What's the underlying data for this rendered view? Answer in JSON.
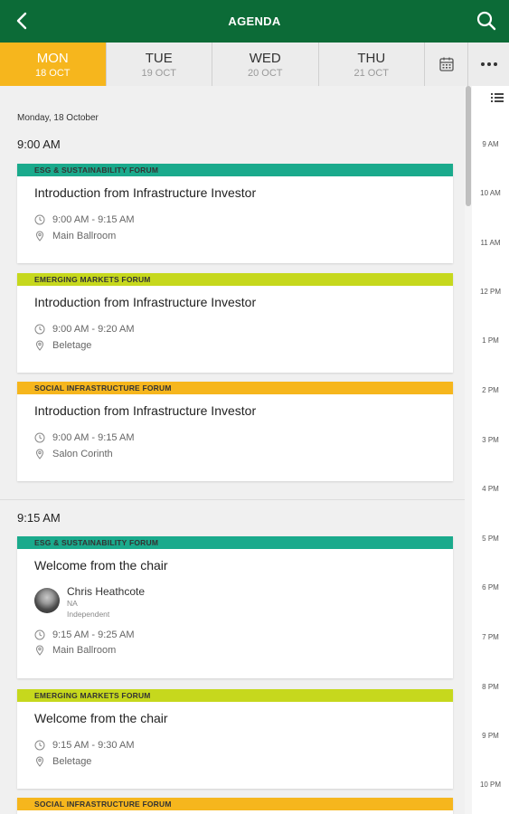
{
  "header": {
    "title": "AGENDA"
  },
  "day_tabs": [
    {
      "name": "MON",
      "date": "18 OCT",
      "active": true
    },
    {
      "name": "TUE",
      "date": "19 OCT",
      "active": false
    },
    {
      "name": "WED",
      "date": "20 OCT",
      "active": false
    },
    {
      "name": "THU",
      "date": "21 OCT",
      "active": false
    }
  ],
  "date_header": "Monday, 18 October",
  "time_groups": [
    {
      "time": "9:00 AM",
      "sessions": [
        {
          "track": "ESG & SUSTAINABILITY FORUM",
          "track_color": "#1aaa8c",
          "title": "Introduction from Infrastructure Investor",
          "time": "9:00 AM - 9:15 AM",
          "location": "Main Ballroom"
        },
        {
          "track": "EMERGING MARKETS FORUM",
          "track_color": "#c6d81d",
          "title": "Introduction from Infrastructure Investor",
          "time": "9:00 AM - 9:20 AM",
          "location": "Beletage"
        },
        {
          "track": "SOCIAL INFRASTRUCTURE FORUM",
          "track_color": "#f6b61d",
          "title": "Introduction from Infrastructure Investor",
          "time": "9:00 AM - 9:15 AM",
          "location": "Salon Corinth"
        }
      ]
    },
    {
      "time": "9:15 AM",
      "sessions": [
        {
          "track": "ESG & SUSTAINABILITY FORUM",
          "track_color": "#1aaa8c",
          "title": "Welcome from the chair",
          "speaker": {
            "name": "Chris Heathcote",
            "title": "NA",
            "org": "Independent"
          },
          "time": "9:15 AM - 9:25 AM",
          "location": "Main Ballroom"
        },
        {
          "track": "EMERGING MARKETS FORUM",
          "track_color": "#c6d81d",
          "title": "Welcome from the chair",
          "time": "9:15 AM - 9:30 AM",
          "location": "Beletage"
        },
        {
          "track": "SOCIAL INFRASTRUCTURE FORUM",
          "track_color": "#f6b61d"
        }
      ]
    }
  ],
  "timeline_labels": [
    "9 AM",
    "10 AM",
    "11 AM",
    "12 PM",
    "1 PM",
    "2 PM",
    "3 PM",
    "4 PM",
    "5 PM",
    "6 PM",
    "7 PM",
    "8 PM",
    "9 PM",
    "10 PM"
  ],
  "colors": {
    "header": "#0c6b37",
    "active_tab": "#f6b61d"
  }
}
